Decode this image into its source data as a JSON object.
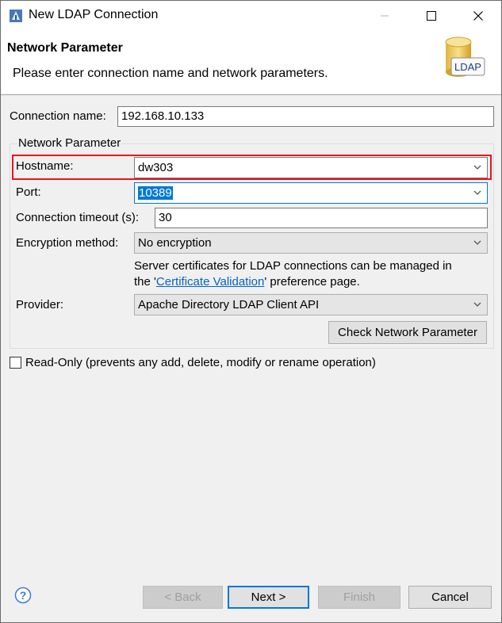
{
  "window": {
    "title": "New LDAP Connection"
  },
  "header": {
    "title": "Network Parameter",
    "description": "Please enter connection name and network parameters.",
    "logo_text": "LDAP"
  },
  "form": {
    "connection_name_label": "Connection name:",
    "connection_name_value": "192.168.10.133",
    "group_title": "Network Parameter",
    "hostname_label": "Hostname:",
    "hostname_value": "dw303",
    "port_label": "Port:",
    "port_value": "10389",
    "timeout_label": "Connection timeout (s):",
    "timeout_value": "30",
    "encryption_label": "Encryption method:",
    "encryption_value": "No encryption",
    "cert_text_1": "Server certificates for LDAP connections can be managed in",
    "cert_text_2_prefix": "the '",
    "cert_link": "Certificate Validation",
    "cert_text_2_suffix": "' preference page.",
    "provider_label": "Provider:",
    "provider_value": "Apache Directory LDAP Client API",
    "check_button": "Check Network Parameter",
    "readonly_label": "Read-Only (prevents any add, delete, modify or rename operation)"
  },
  "footer": {
    "back": "< Back",
    "next": "Next >",
    "finish": "Finish",
    "cancel": "Cancel"
  },
  "colors": {
    "highlight": "#e8141e",
    "selection": "#0078d7",
    "link": "#0563c1"
  }
}
